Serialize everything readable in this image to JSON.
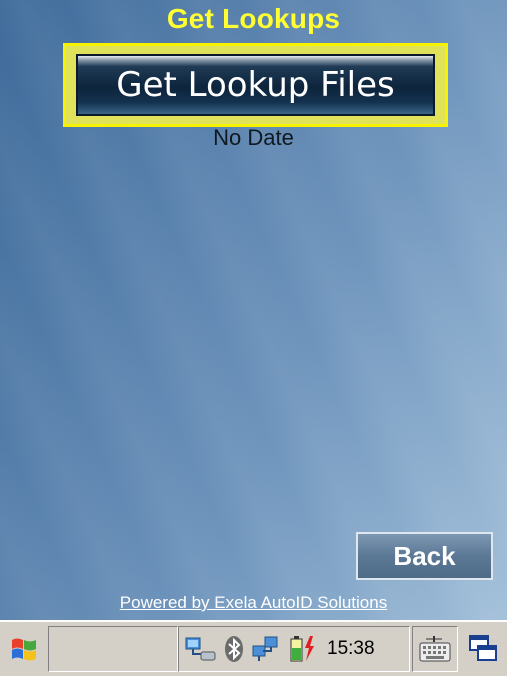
{
  "app": {
    "title": "Get Lookups",
    "primary_button_label": "Get Lookup Files",
    "date_status": "No Date",
    "back_button_label": "Back",
    "powered_by_link": "Powered by Exela AutoID Solutions"
  },
  "taskbar": {
    "clock": "15:38",
    "icons": [
      "windows-start-icon",
      "network-icon",
      "bluetooth-icon",
      "connectivity-icon",
      "battery-charging-icon",
      "keyboard-icon",
      "window-switch-icon"
    ]
  },
  "colors": {
    "title": "#ffff33",
    "highlight_border": "#f6f200",
    "background_start": "#3e6a9a",
    "background_end": "#a3c0da",
    "taskbar": "#d4d0c8"
  }
}
